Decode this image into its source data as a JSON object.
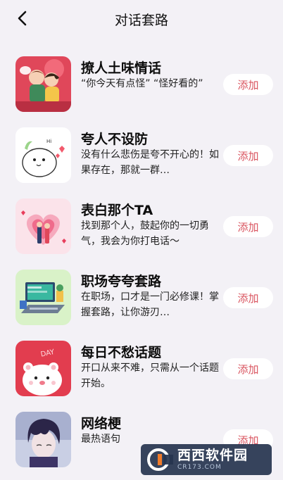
{
  "header": {
    "title": "对话套路",
    "back_icon": "chevron-left-icon"
  },
  "colors": {
    "background": "#f3f1f6",
    "button_text": "#d9545f",
    "button_bg": "#ffffff"
  },
  "items": [
    {
      "name": "撩人土味情话",
      "desc": "“你今天有点怪” “怪好看的”",
      "button": "添加",
      "thumb": "couple-cartoon-thumbnail"
    },
    {
      "name": "夸人不设防",
      "desc": "没有什么悲伤是夸不开心的！如果存在，那就一群…",
      "button": "添加",
      "thumb": "cute-blob-thumbnail"
    },
    {
      "name": "表白那个TA",
      "desc": "找到那个人，鼓起你的一切勇气，我会为你打电话～",
      "button": "添加",
      "thumb": "heart-couple-thumbnail"
    },
    {
      "name": "职场夸夸套路",
      "desc": "在职场，口才是一门必修课！掌握套路，让你游刃…",
      "button": "添加",
      "thumb": "office-desk-thumbnail"
    },
    {
      "name": "每日不愁话题",
      "desc": "开口从来不难，只需从一个话题开始。",
      "button": "添加",
      "thumb": "bear-day-thumbnail"
    },
    {
      "name": "网络梗",
      "desc": "最热语句",
      "button": "添加",
      "thumb": "anime-boy-thumbnail"
    }
  ],
  "watermark": {
    "main": "西西软件园",
    "sub": "CR173.COM"
  }
}
